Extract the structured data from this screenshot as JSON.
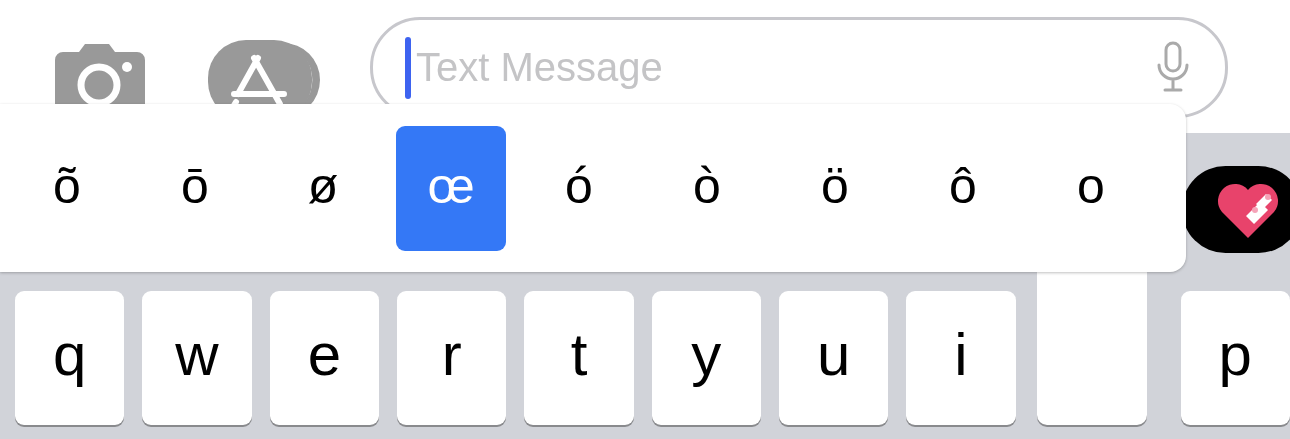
{
  "message_field": {
    "placeholder": "Text Message"
  },
  "accent_popup": {
    "options": [
      {
        "label": "õ",
        "selected": false
      },
      {
        "label": "ō",
        "selected": false
      },
      {
        "label": "ø",
        "selected": false
      },
      {
        "label": "œ",
        "selected": true
      },
      {
        "label": "ó",
        "selected": false
      },
      {
        "label": "ò",
        "selected": false
      },
      {
        "label": "ö",
        "selected": false
      },
      {
        "label": "ô",
        "selected": false
      },
      {
        "label": "o",
        "selected": false
      }
    ]
  },
  "keyboard": {
    "keys_left": [
      "q",
      "w",
      "e",
      "r",
      "t",
      "y",
      "u",
      "i"
    ],
    "keys_right": [
      "p"
    ]
  }
}
